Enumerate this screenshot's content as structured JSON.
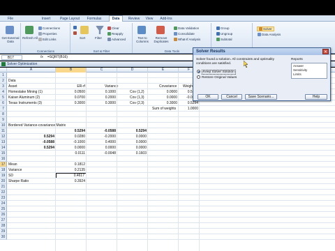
{
  "ribbon": {
    "tabs": [
      "File",
      "Insert",
      "Page Layout",
      "Formulas",
      "Data",
      "Review",
      "View",
      "Add-Ins"
    ],
    "active_tab": "Data",
    "groups": {
      "external": {
        "label": "Get External Data"
      },
      "connections": {
        "label": "Connections",
        "refresh": "Refresh All",
        "items": [
          "Connections",
          "Properties",
          "Edit Links"
        ]
      },
      "sortfilter": {
        "label": "Sort & Filter",
        "sort": "Sort",
        "filter": "Filter",
        "items": [
          "Clear",
          "Reapply",
          "Advanced"
        ]
      },
      "datatools": {
        "label": "Data Tools",
        "text_to_columns": "Text to Columns",
        "remove_duplicates": "Remove Duplicates",
        "items": [
          "Data Validation",
          "Consolidate",
          "What-If Analysis"
        ]
      },
      "outline": {
        "label": "Outline",
        "items": [
          "Group",
          "Ungroup",
          "Subtotal"
        ]
      },
      "analysis": {
        "label": "Analysis",
        "items": [
          "Solver",
          "Data Analysis"
        ]
      }
    }
  },
  "formula_bar": {
    "name_box": "B17",
    "fx": "fx",
    "formula": "=SQRT(B16)"
  },
  "window": {
    "title": "Solver Optimization"
  },
  "columns": [
    "A",
    "B",
    "C",
    "D",
    "E",
    "F"
  ],
  "selected_col": "B",
  "selected_row": "17",
  "rows": [
    "1",
    "2",
    "3",
    "4",
    "5",
    "6",
    "7",
    "8",
    "9",
    "10",
    "11",
    "12",
    "13",
    "14",
    "15",
    "16",
    "17",
    "18",
    "19",
    "20",
    "21",
    "22",
    "23",
    "24",
    "25",
    "26",
    "27",
    "28",
    "29",
    "30"
  ],
  "cells": {
    "a1": "Data",
    "a2": "Asset",
    "b2": "ER-rf",
    "c2": "Variance",
    "e2": "Covariance",
    "f2": "Weights",
    "a3": "Homestake Mining (1)",
    "b3": "0.0500",
    "c3": "0.1000",
    "d3": "Cov (1,2)",
    "e3": "0.0000",
    "f3": "0.5294",
    "a4": "Kaiser Aluminum (2)",
    "b4": "0.0700",
    "c4": "0.2000",
    "d4": "Cov (1,3)",
    "e4": "0.0000",
    "f4": "-0.0588",
    "a5": "Texas Instruments (3)",
    "b5": "0.3000",
    "c5": "0.3000",
    "d5": "Cov (2,3)",
    "e5": "0.3000",
    "f5": "0.5294",
    "e6": "Sum of weights",
    "f6": "1.0000",
    "a8": "Bordered Variance-covariance Matrix",
    "b9": "0.5294",
    "c9": "-0.0588",
    "d9": "0.5294",
    "a10": "0.5294",
    "b10": "0.0280",
    "c10": "-0.2000",
    "d10": "0.0000",
    "a11": "-0.0588",
    "b11": "-0.1000",
    "c11": "0.4000",
    "d11": "0.0000",
    "a12": "0.5294",
    "b12": "0.0000",
    "c12": "0.0000",
    "d12": "0.0000",
    "b13": "0.0111",
    "c13": "-0.0048",
    "d13": "0.1603",
    "a15": "Mean",
    "b15": "0.1812",
    "a16": "Variance",
    "b16": "0.2135",
    "a17": "SD",
    "b17": "0.4617",
    "a18": "Sharpe Ratio",
    "b18": "0.3924"
  },
  "dialog": {
    "title": "Solver Results",
    "message": "Solver found a solution.  All constraints and optimality conditions are satisfied.",
    "reports_label": "Reports",
    "reports": [
      "Answer",
      "Sensitivity",
      "Limits"
    ],
    "keep_solution": "Keep Solver Solution",
    "restore_values": "Restore Original Values",
    "ok": "OK",
    "cancel": "Cancel",
    "save_scenario": "Save Scenario...",
    "help": "Help"
  }
}
